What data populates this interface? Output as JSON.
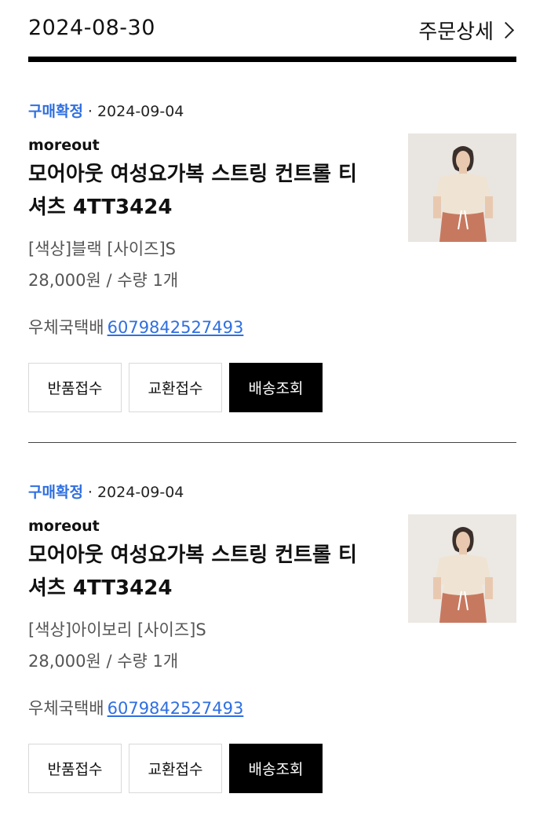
{
  "header": {
    "date": "2024-08-30",
    "detail_label": "주문상세"
  },
  "items": [
    {
      "status": "구매확정",
      "date": "2024-09-04",
      "brand": "moreout",
      "title": "모어아웃 여성요가복 스트링 컨트롤 티셔츠 4TT3424",
      "options": "[색상]블랙 [사이즈]S",
      "price_qty": "28,000원 / 수량 1개",
      "courier": "우체국택배",
      "tracking": "6079842527493",
      "buttons": {
        "return": "반품접수",
        "exchange": "교환접수",
        "track": "배송조회"
      }
    },
    {
      "status": "구매확정",
      "date": "2024-09-04",
      "brand": "moreout",
      "title": "모어아웃 여성요가복 스트링 컨트롤 티셔츠 4TT3424",
      "options": "[색상]아이보리 [사이즈]S",
      "price_qty": "28,000원 / 수량 1개",
      "courier": "우체국택배",
      "tracking": "6079842527493",
      "buttons": {
        "return": "반품접수",
        "exchange": "교환접수",
        "track": "배송조회"
      }
    }
  ],
  "colors": {
    "status": "#2f6fe0",
    "link": "#2f6fe0",
    "dark_button": "#000000"
  }
}
